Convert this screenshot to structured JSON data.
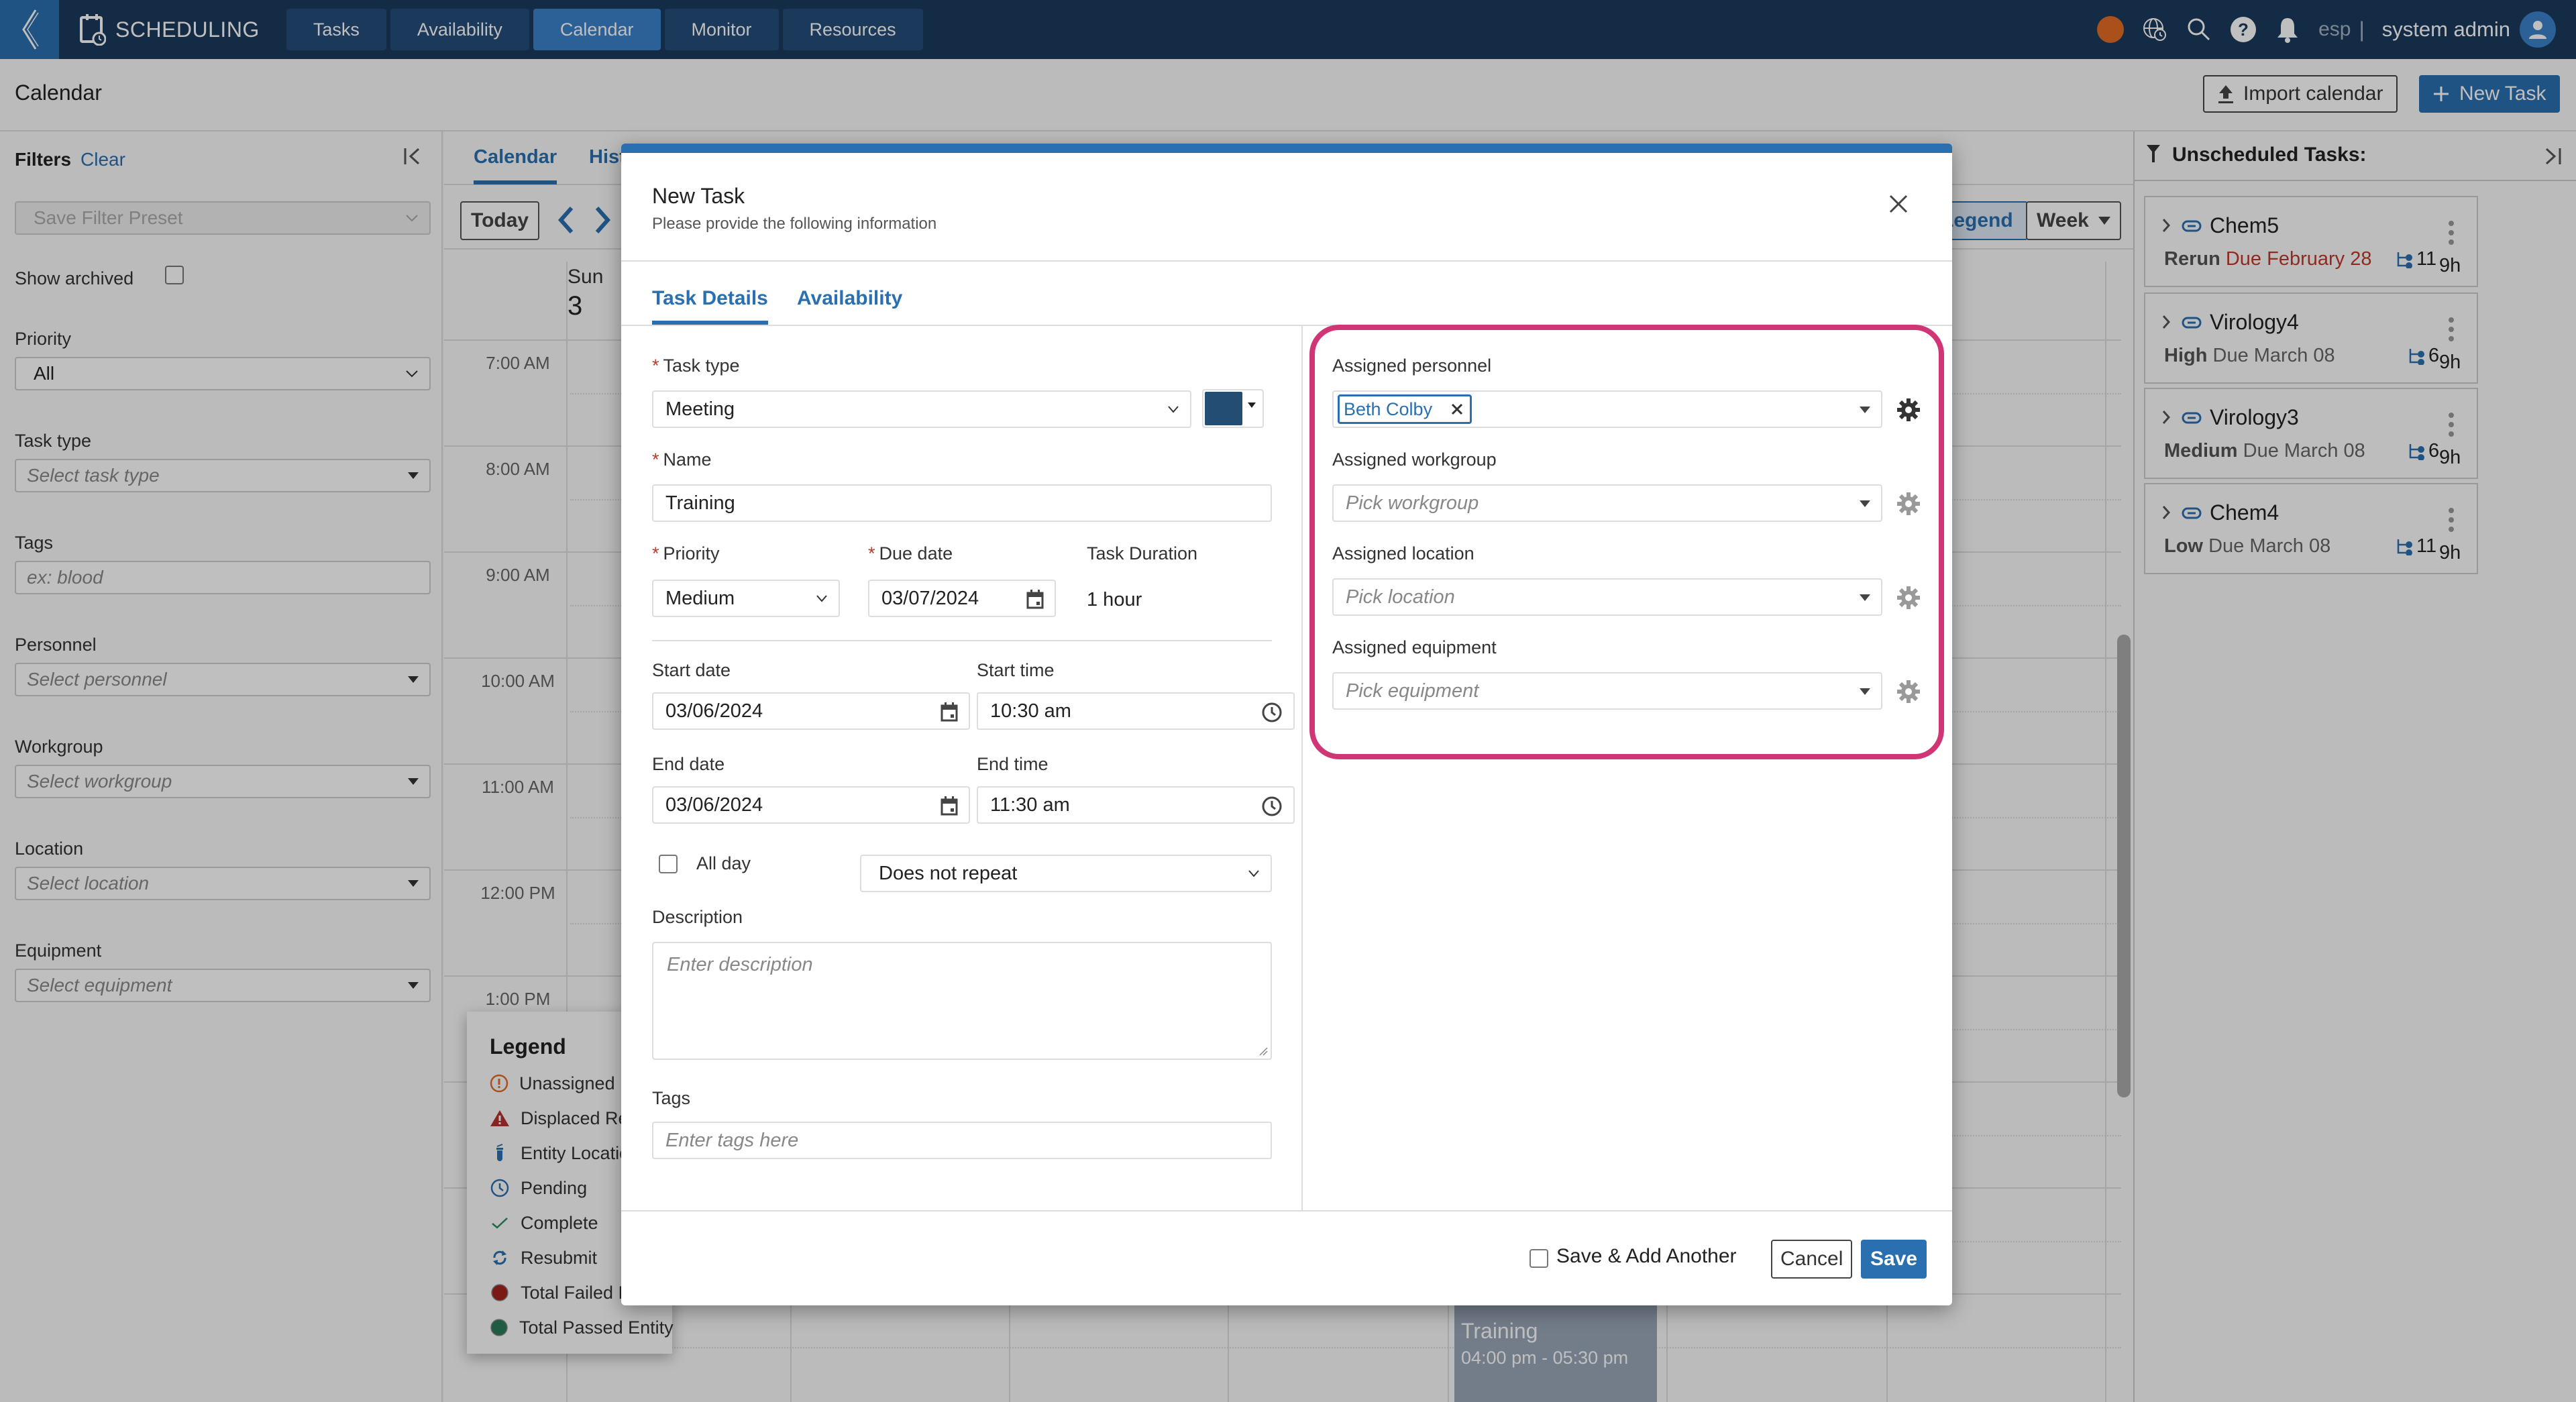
{
  "app": {
    "name": "SCHEDULING",
    "nav_tabs": [
      {
        "label": "Tasks",
        "active": false
      },
      {
        "label": "Availability",
        "active": false
      },
      {
        "label": "Calendar",
        "active": true
      },
      {
        "label": "Monitor",
        "active": false
      },
      {
        "label": "Resources",
        "active": false
      }
    ],
    "status_color": "#e36c25",
    "language": "esp",
    "separator": "|",
    "user": "system admin"
  },
  "page": {
    "title": "Calendar",
    "import_button": "Import calendar",
    "new_task_button": "New Task"
  },
  "filters": {
    "title": "Filters",
    "clear": "Clear",
    "preset_placeholder": "Save Filter Preset",
    "show_archived": "Show archived",
    "priority_label": "Priority",
    "priority_value": "All",
    "task_type_label": "Task type",
    "task_type_placeholder": "Select task type",
    "tags_label": "Tags",
    "tags_placeholder": "ex: blood",
    "personnel_label": "Personnel",
    "personnel_placeholder": "Select personnel",
    "workgroup_label": "Workgroup",
    "workgroup_placeholder": "Select workgroup",
    "location_label": "Location",
    "location_placeholder": "Select location",
    "equipment_label": "Equipment",
    "equipment_placeholder": "Select equipment"
  },
  "calendar": {
    "tabs": [
      {
        "label": "Calendar",
        "active": true
      },
      {
        "label": "History",
        "active": false
      }
    ],
    "today_button": "Today",
    "legend_button": "Legend",
    "view_button": "Week",
    "day_name": "Sun",
    "day_number": "3",
    "hours": [
      "7:00 AM",
      "8:00 AM",
      "9:00 AM",
      "10:00 AM",
      "11:00 AM",
      "12:00 PM",
      "1:00 PM"
    ],
    "event": {
      "name": "Training",
      "time": "04:00 pm - 05:30 pm"
    }
  },
  "legend": {
    "title": "Legend",
    "items": [
      {
        "icon": "unassigned-icon",
        "label": "Unassigned Resource"
      },
      {
        "icon": "displaced-warning-icon",
        "label": "Displaced Resource"
      },
      {
        "icon": "entity-location-tube-icon",
        "label": "Entity Location"
      },
      {
        "icon": "pending-clock-icon",
        "label": "Pending"
      },
      {
        "icon": "complete-check-icon",
        "label": "Complete"
      },
      {
        "icon": "resubmit-icon",
        "label": "Resubmit"
      },
      {
        "icon": "failed-dot-icon",
        "label": "Total Failed Entity"
      },
      {
        "icon": "passed-dot-icon",
        "label": "Total Passed Entity"
      }
    ],
    "colors": {
      "unassigned": "#e36c25",
      "displaced": "#b5322b",
      "info": "#2a6fb0",
      "complete": "#2f8a5b",
      "failed": "#a3231f",
      "passed": "#2b7a5a"
    }
  },
  "unscheduled": {
    "title": "Unscheduled Tasks:",
    "tasks": [
      {
        "name": "Chem5",
        "priority": "Rerun",
        "due": "Due February 28",
        "overdue": true,
        "count": "11",
        "duration": "9h"
      },
      {
        "name": "Virology4",
        "priority": "High",
        "due": "Due March 08",
        "overdue": false,
        "count": "6",
        "duration": "9h"
      },
      {
        "name": "Virology3",
        "priority": "Medium",
        "due": "Due March 08",
        "overdue": false,
        "count": "6",
        "duration": "9h"
      },
      {
        "name": "Chem4",
        "priority": "Low",
        "due": "Due March 08",
        "overdue": false,
        "count": "11",
        "duration": "9h"
      }
    ]
  },
  "modal": {
    "title": "New Task",
    "subtitle": "Please provide the following information",
    "tabs": [
      {
        "label": "Task Details",
        "active": true
      },
      {
        "label": "Availability",
        "active": false
      }
    ],
    "required_mark": "*",
    "task_type_label": "Task type",
    "task_type_value": "Meeting",
    "task_color": "#234d72",
    "name_label": "Name",
    "name_value": "Training",
    "priority_label": "Priority",
    "priority_value": "Medium",
    "due_date_label": "Due date",
    "due_date_value": "03/07/2024",
    "duration_label": "Task Duration",
    "duration_value": "1 hour",
    "start_date_label": "Start date",
    "start_date_value": "03/06/2024",
    "start_time_label": "Start time",
    "start_time_value": "10:30 am",
    "end_date_label": "End date",
    "end_date_value": "03/06/2024",
    "end_time_label": "End time",
    "end_time_value": "11:30 am",
    "all_day_label": "All day",
    "all_day_checked": false,
    "repeat_value": "Does not repeat",
    "description_label": "Description",
    "description_placeholder": "Enter description",
    "tags_label": "Tags",
    "tags_placeholder": "Enter tags here",
    "assigned_personnel_label": "Assigned personnel",
    "assigned_personnel_chip": "Beth Colby",
    "assigned_workgroup_label": "Assigned workgroup",
    "assigned_workgroup_placeholder": "Pick workgroup",
    "assigned_location_label": "Assigned location",
    "assigned_location_placeholder": "Pick location",
    "assigned_equipment_label": "Assigned equipment",
    "assigned_equipment_placeholder": "Pick equipment",
    "highlight_color": "#d03575",
    "save_add_another_label": "Save & Add Another",
    "cancel_button": "Cancel",
    "save_button": "Save"
  }
}
